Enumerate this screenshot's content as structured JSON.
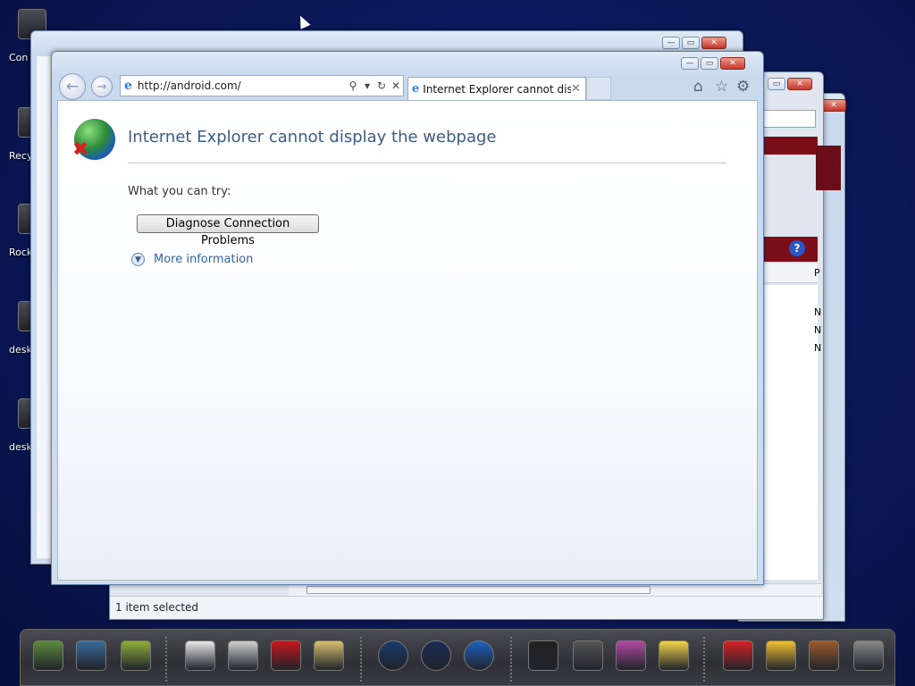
{
  "desktop": {
    "icons": [
      {
        "label": "Con",
        "icon": "computer-icon"
      },
      {
        "label": "Recy",
        "icon": "recycle-bin-icon"
      },
      {
        "label": "Rock",
        "icon": "app-icon"
      },
      {
        "label": "desk",
        "icon": "gear-icon"
      },
      {
        "label": "desk",
        "icon": "gear-icon"
      }
    ]
  },
  "background_window": {
    "status_text": "1 item selected",
    "column_letter": "P",
    "list_letters": [
      "N",
      "N",
      "N"
    ],
    "help_icon": "?"
  },
  "browser": {
    "address": {
      "url": "http://android.com/",
      "ie_glyph": "e",
      "search_glyph": "⚲",
      "dropdown_glyph": "▾",
      "refresh_glyph": "↻",
      "stop_glyph": "✕"
    },
    "tab": {
      "title": "Internet Explorer cannot dis...",
      "close_glyph": "✕"
    },
    "toolbar": {
      "back_glyph": "←",
      "forward_glyph": "→",
      "home_glyph": "⌂",
      "favorites_glyph": "☆",
      "tools_glyph": "⚙"
    },
    "window_controls": {
      "minimize": "—",
      "maximize": "▭",
      "close": "✕"
    }
  },
  "error_page": {
    "title": "Internet Explorer cannot display the webpage",
    "try_label": "What you can try:",
    "diagnose_button": "Diagnose Connection Problems",
    "more_information": "More information",
    "more_glyph": "▼"
  },
  "taskbar": {
    "items": [
      {
        "icon": "android-desktop-icon",
        "color": "#5c8a3a"
      },
      {
        "icon": "globe-desktop-icon",
        "color": "#3a6a9a"
      },
      {
        "icon": "android-folder-icon",
        "color": "#8fae3c"
      },
      {
        "icon": "play-store-icon",
        "color": "#e8e8e8"
      },
      {
        "icon": "gmail-icon",
        "color": "#d0d0d0"
      },
      {
        "icon": "youtube-icon",
        "color": "#c4161c"
      },
      {
        "icon": "maps-icon",
        "color": "#d9c070"
      },
      {
        "icon": "camera-icon",
        "color": "#1a3a6a"
      },
      {
        "icon": "speaker-icon",
        "color": "#1b2a55"
      },
      {
        "icon": "browser-globe-icon",
        "color": "#1f5fbf"
      },
      {
        "icon": "display-icon",
        "color": "#222222"
      },
      {
        "icon": "calculator-icon",
        "color": "#555555"
      },
      {
        "icon": "gallery-icon",
        "color": "#b04aa0"
      },
      {
        "icon": "notes-icon",
        "color": "#f0d44a"
      },
      {
        "icon": "angry-birds-icon",
        "color": "#d42424"
      },
      {
        "icon": "weather-icon",
        "color": "#f0c030"
      },
      {
        "icon": "android-robot-icon",
        "color": "#9a5a2a"
      },
      {
        "icon": "trash-icon",
        "color": "#888888"
      }
    ]
  }
}
